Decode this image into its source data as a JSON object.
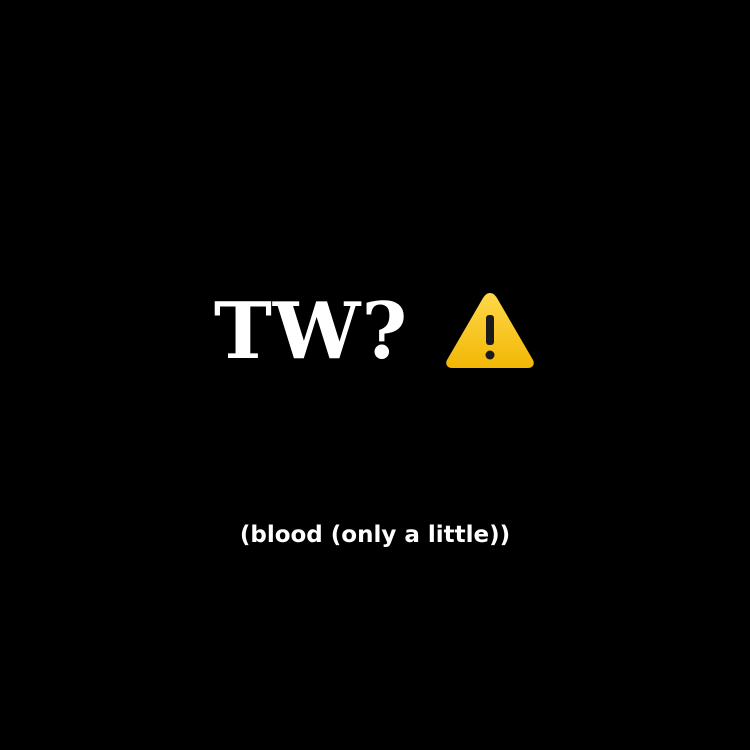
{
  "heading": {
    "text": "TW?",
    "icon": "warning-icon",
    "icon_color": "#f7c21a"
  },
  "subtitle": {
    "text": "(blood (only a little))"
  },
  "colors": {
    "background": "#000000",
    "text": "#ffffff"
  }
}
